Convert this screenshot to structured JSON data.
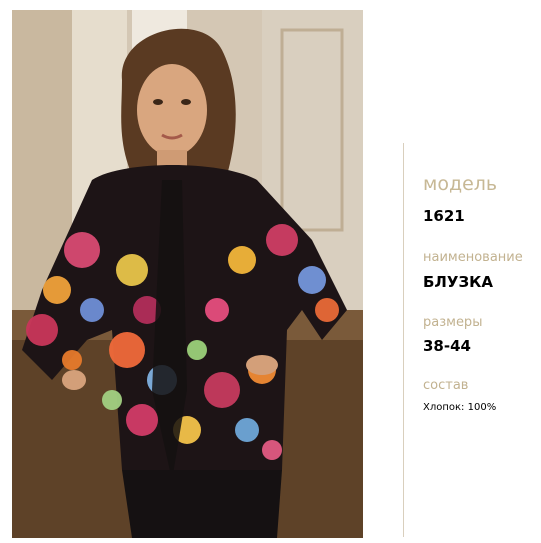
{
  "product": {
    "model_label": "модель",
    "model_value": "1621",
    "name_label": "наименование",
    "name_value": "БЛУЗКА",
    "sizes_label": "размеры",
    "sizes_value": "38-44",
    "composition_label": "состав",
    "composition_value": "Хлопок: 100%"
  },
  "photo": {
    "description_icon": "model-photo-floral-blouse"
  },
  "colors": {
    "label": "#c2b290",
    "divider": "#d9cfbd",
    "value": "#000000"
  }
}
